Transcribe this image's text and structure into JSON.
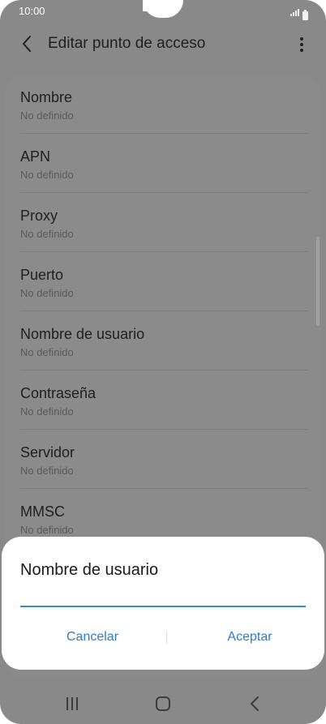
{
  "status_bar": {
    "time": "10:00",
    "icons": [
      "signal-icon",
      "battery-icon"
    ]
  },
  "header": {
    "title": "Editar punto de acceso",
    "back_icon": "back-arrow-icon",
    "menu_icon": "more-vert-icon"
  },
  "list": {
    "items": [
      {
        "label": "Nombre",
        "value": "No definido"
      },
      {
        "label": "APN",
        "value": "No definido"
      },
      {
        "label": "Proxy",
        "value": "No definido"
      },
      {
        "label": "Puerto",
        "value": "No definido"
      },
      {
        "label": "Nombre de usuario",
        "value": "No definido"
      },
      {
        "label": "Contraseña",
        "value": "No definido"
      },
      {
        "label": "Servidor",
        "value": "No definido"
      },
      {
        "label": "MMSC",
        "value": "No definido"
      }
    ]
  },
  "dialog": {
    "title": "Nombre de usuario",
    "input_value": "",
    "cancel_label": "Cancelar",
    "ok_label": "Aceptar"
  },
  "nav_bar": {
    "icons": [
      "recent-apps-icon",
      "home-icon",
      "back-icon"
    ]
  },
  "colors": {
    "accent": "#2b7ec8",
    "input_underline": "#3a8ad6",
    "scrim": "#898989"
  }
}
